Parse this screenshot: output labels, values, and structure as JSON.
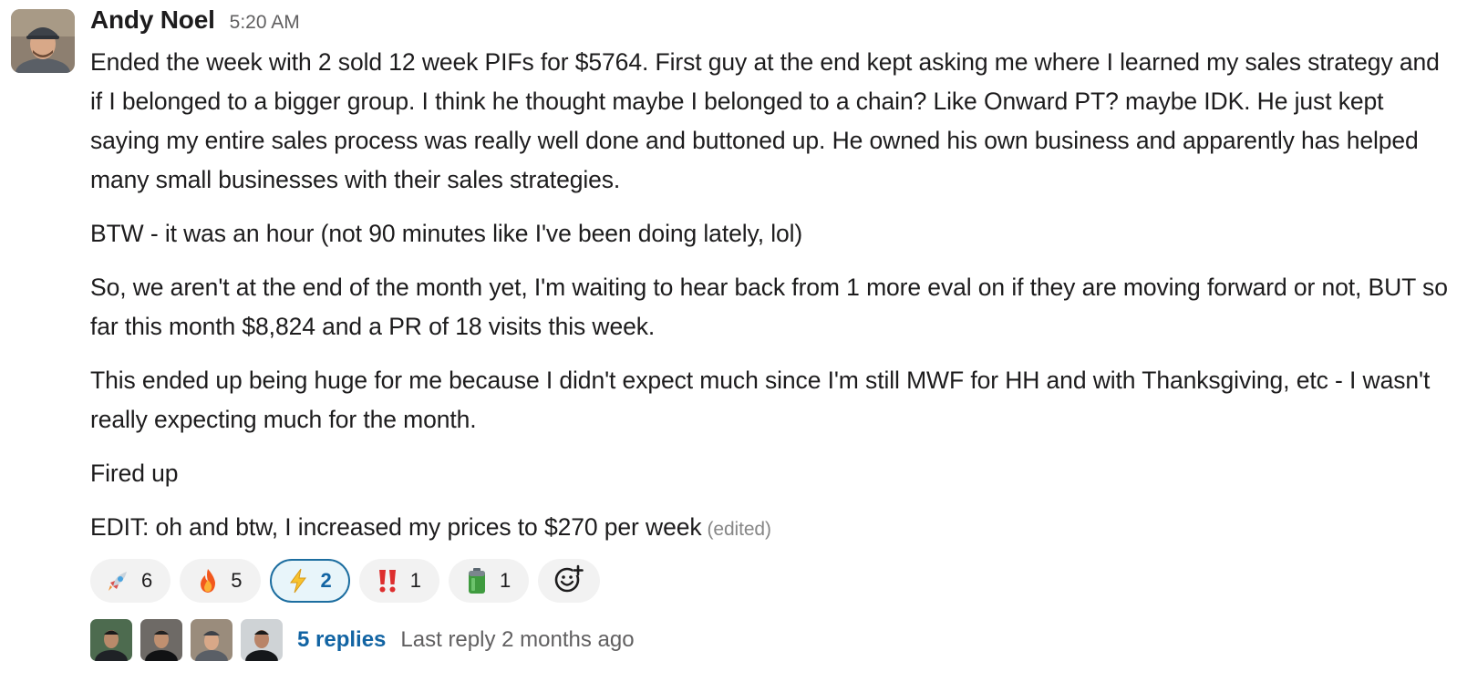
{
  "message": {
    "author": "Andy Noel",
    "timestamp": "5:20 AM",
    "paragraphs": [
      "Ended the week with 2 sold 12 week PIFs for $5764. First guy at the end kept asking me where I learned my sales strategy and if I belonged to a bigger group. I think he thought maybe I belonged to a chain? Like Onward PT? maybe IDK. He just kept saying my entire sales process was really well done and buttoned up. He owned his own business and apparently has helped many small businesses with their sales strategies.",
      "BTW - it was an hour (not 90 minutes like I've been doing lately, lol)",
      "So, we aren't at the end of the month yet, I'm waiting to hear back from 1 more eval on if they are moving forward or not, BUT so far this month $8,824 and a PR of 18 visits this week.",
      "This ended up being huge for me because I didn't expect much since I'm still MWF for HH and with Thanksgiving, etc - I wasn't really expecting much for the month.",
      "Fired up",
      "EDIT: oh and btw, I increased my prices to $270 per week"
    ],
    "edited_label": "(edited)"
  },
  "reactions": [
    {
      "icon": "rocket-icon",
      "count": "6",
      "active": false
    },
    {
      "icon": "fire-icon",
      "count": "5",
      "active": false
    },
    {
      "icon": "zap-icon",
      "count": "2",
      "active": true
    },
    {
      "icon": "double-exclamation-icon",
      "count": "1",
      "active": false
    },
    {
      "icon": "battery-icon",
      "count": "1",
      "active": false
    }
  ],
  "thread": {
    "reply_count": "5 replies",
    "last_reply": "Last reply 2 months ago"
  },
  "colors": {
    "link": "#1264a3",
    "active_reaction_bg": "#e8f5fa",
    "active_reaction_border": "#1d6ea0",
    "muted": "#616061"
  }
}
